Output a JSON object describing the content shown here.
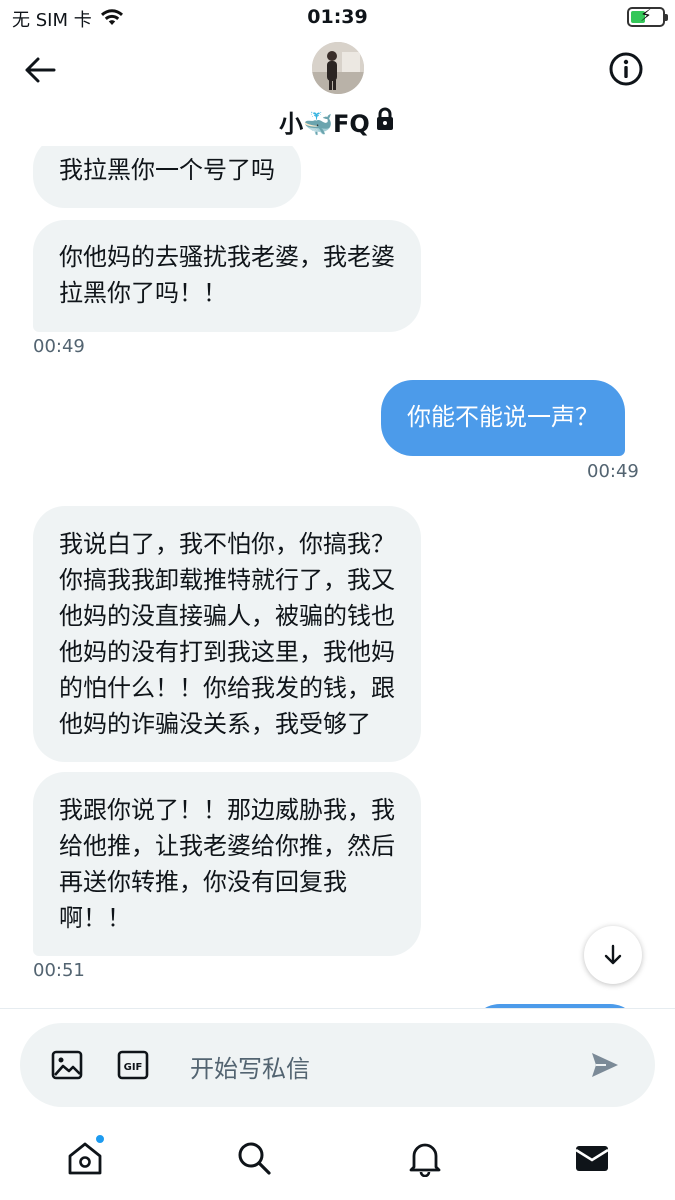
{
  "status_bar": {
    "carrier": "无 SIM 卡",
    "time": "01:39",
    "battery_level": 0.45
  },
  "header": {
    "contact_name": "小🐳FQ",
    "verified_locked": true
  },
  "messages": [
    {
      "direction": "in",
      "text_lines": [
        "我拉黑你一个号了吗"
      ]
    },
    {
      "direction": "in",
      "text_lines": [
        "你他妈的去骚扰我老婆，我老婆",
        "拉黑你了吗！！"
      ]
    },
    {
      "timestamp": "00:49",
      "side": "left"
    },
    {
      "direction": "out",
      "text_lines": [
        "你能不能说一声？"
      ]
    },
    {
      "timestamp": "00:49",
      "side": "right"
    },
    {
      "direction": "in",
      "text_lines": [
        "我说白了，我不怕你，你搞我？",
        "你搞我我卸载推特就行了，我又",
        "他妈的没直接骗人，被骗的钱也",
        "他妈的没有打到我这里，我他妈",
        "的怕什么！！你给我发的钱，跟",
        "他妈的诈骗没关系，我受够了"
      ]
    },
    {
      "direction": "in",
      "text_lines": [
        "我跟你说了！！那边威胁我，我",
        "给他推，让我老婆给你推，然后",
        "再送你转推，你没有回复我",
        "啊！！"
      ]
    },
    {
      "timestamp": "00:51",
      "side": "left"
    }
  ],
  "composer": {
    "placeholder": "开始写私信",
    "gif_label": "GIF"
  },
  "colors": {
    "incoming_bubble": "#eff3f4",
    "outgoing_bubble": "#4c9bea",
    "accent": "#1d9bf0"
  },
  "tabbar": {
    "items": [
      "home-icon",
      "search-icon",
      "bell-icon",
      "mail-icon"
    ],
    "active": "mail-icon"
  }
}
